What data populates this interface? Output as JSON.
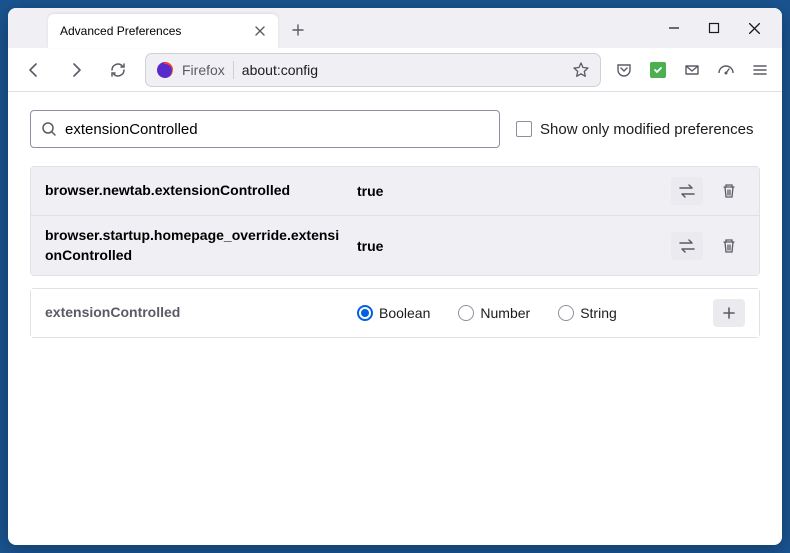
{
  "tab": {
    "title": "Advanced Preferences"
  },
  "urlbar": {
    "domain": "Firefox",
    "path": "about:config"
  },
  "search": {
    "value": "extensionControlled",
    "checkbox_label": "Show only modified preferences"
  },
  "prefs": [
    {
      "name": "browser.newtab.extensionControlled",
      "value": "true"
    },
    {
      "name": "browser.startup.homepage_override.extensionControlled",
      "value": "true"
    }
  ],
  "newpref": {
    "name": "extensionControlled",
    "types": {
      "boolean": "Boolean",
      "number": "Number",
      "string": "String"
    }
  }
}
